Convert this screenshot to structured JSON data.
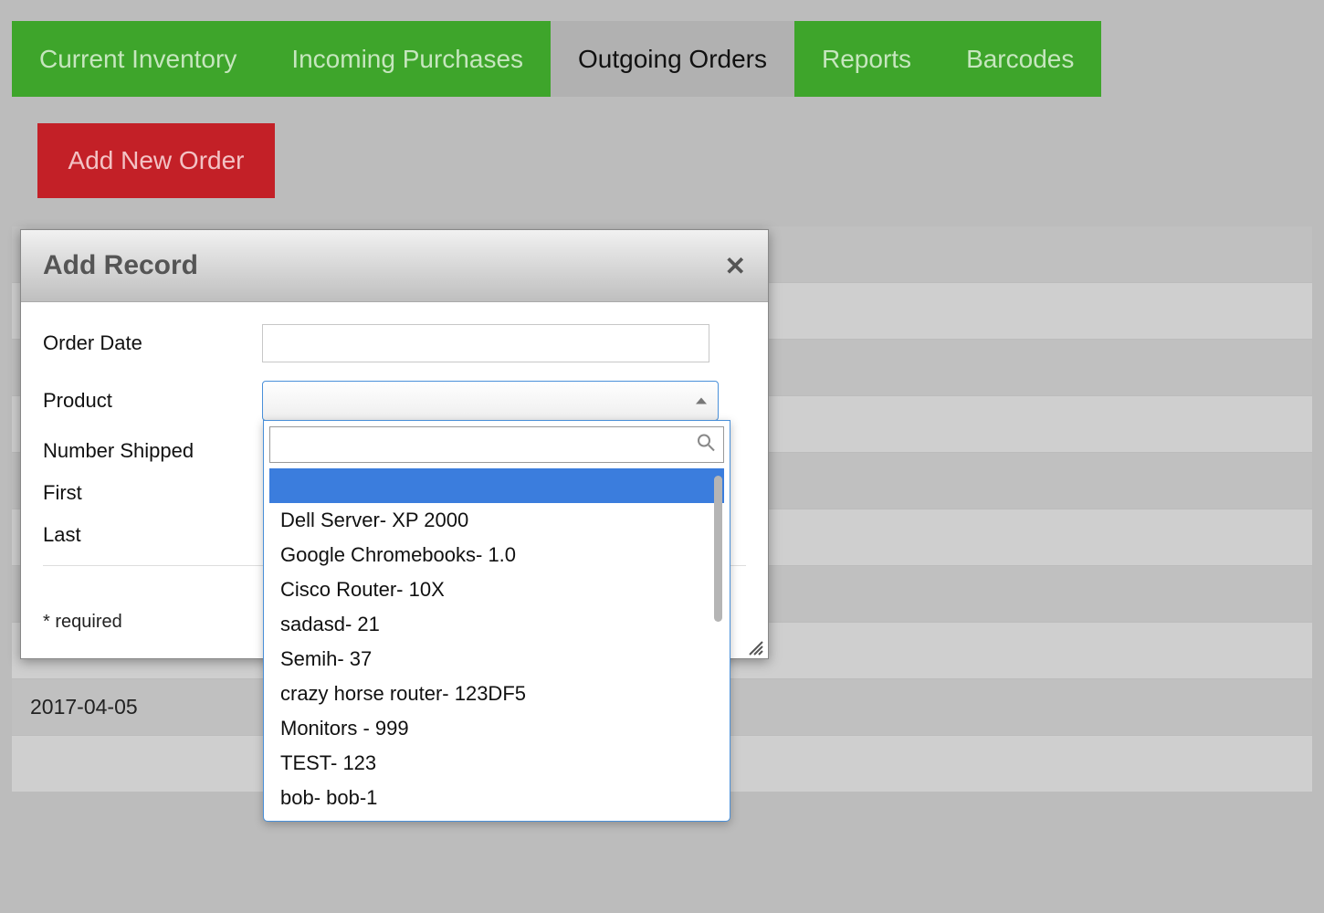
{
  "tabs": [
    {
      "label": "Current Inventory",
      "active": false
    },
    {
      "label": "Incoming Purchases",
      "active": false
    },
    {
      "label": "Outgoing Orders",
      "active": true
    },
    {
      "label": "Reports",
      "active": false
    },
    {
      "label": "Barcodes",
      "active": false
    }
  ],
  "add_order_button": "Add New Order",
  "dialog": {
    "title": "Add Record",
    "fields": {
      "order_date": {
        "label": "Order Date",
        "value": ""
      },
      "product": {
        "label": "Product"
      },
      "number_shipped": {
        "label": "Number Shipped"
      },
      "first": {
        "label": "First"
      },
      "last": {
        "label": "Last"
      }
    },
    "required_note": "* required"
  },
  "product_dropdown": {
    "search_value": "",
    "options": [
      "",
      "Dell Server- XP 2000",
      "Google Chromebooks- 1.0",
      "Cisco Router- 10X",
      "sadasd- 21",
      "Semih- 37",
      "crazy horse router- 123DF5",
      "Monitors - 999",
      "TEST- 123",
      "bob- bob-1"
    ],
    "highlight_index": 0
  },
  "background_rows": [
    "",
    "",
    "",
    "",
    "",
    "",
    "",
    "",
    "2017-04-05",
    ""
  ]
}
